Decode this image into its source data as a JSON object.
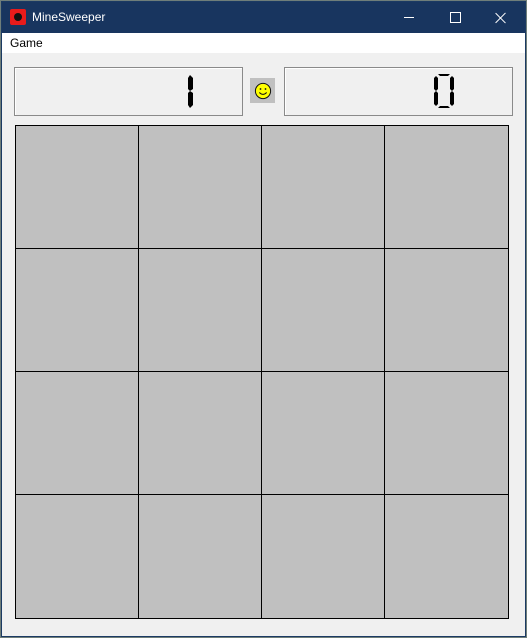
{
  "window": {
    "title": "MineSweeper",
    "icon": "mine-app-icon",
    "controls": [
      "minimize-icon",
      "maximize-icon",
      "close-icon"
    ]
  },
  "menu": {
    "items": [
      {
        "label": "Game"
      }
    ]
  },
  "status": {
    "mines_remaining": "1",
    "timer": "0",
    "face": "smiley-face-icon"
  },
  "board": {
    "rows": 4,
    "columns": 4,
    "cell_state": "unrevealed",
    "cell_color": "#c0c0c0"
  },
  "colors": {
    "titlebar": "#18355f",
    "digit": "#000000",
    "smiley": "#ffff00"
  }
}
